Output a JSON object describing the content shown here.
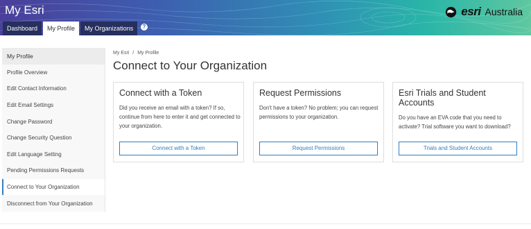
{
  "header": {
    "app_title": "My Esri",
    "logo_text": "esri",
    "logo_region": "Australia",
    "colors": {
      "gradient_start": "#4a3f9a",
      "gradient_end": "#5fc8a0",
      "accent": "#2f7ec0"
    }
  },
  "tabs": [
    {
      "label": "Dashboard"
    },
    {
      "label": "My Profile"
    },
    {
      "label": "My Organizations"
    }
  ],
  "help_icon": "?",
  "sidebar": {
    "items": [
      {
        "label": "My Profile"
      },
      {
        "label": "Profile Overview"
      },
      {
        "label": "Edit Contact Information"
      },
      {
        "label": "Edit Email Settings"
      },
      {
        "label": "Change Password"
      },
      {
        "label": "Change Security Question"
      },
      {
        "label": "Edit Language Setting"
      },
      {
        "label": "Pending Permissions Requests"
      },
      {
        "label": "Connect to Your Organization"
      },
      {
        "label": "Disconnect from Your Organization"
      }
    ]
  },
  "breadcrumb": {
    "root": "My Esri",
    "separator": "/",
    "current": "My Profile"
  },
  "page_title": "Connect to Your Organization",
  "cards": [
    {
      "title": "Connect with a Token",
      "description": "Did you receive an email with a token? If so, continue from here to enter it and get connected to your organization.",
      "button": "Connect with a Token"
    },
    {
      "title": "Request Permissions",
      "description": "Don't have a token? No problem; you can request permissions to your organization.",
      "button": "Request Permissions"
    },
    {
      "title": "Esri Trials and Student Accounts",
      "description": "Do you have an EVA code that you need to activate? Trial software you want to download?",
      "button": "Trials and Student Accounts"
    }
  ]
}
